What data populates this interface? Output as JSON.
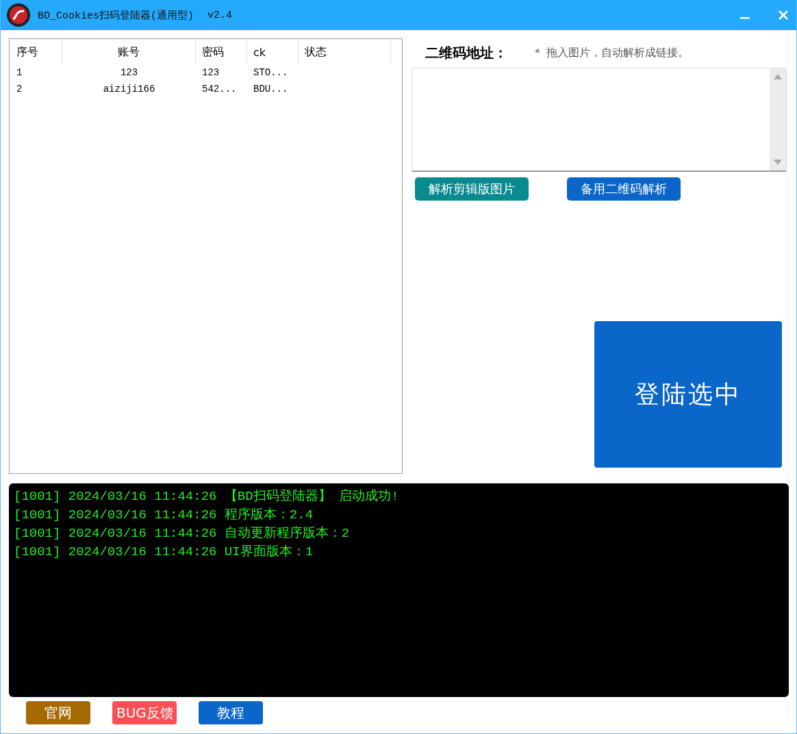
{
  "window": {
    "title": "BD_Cookies扫码登陆器(通用型)",
    "version": "v2.4"
  },
  "table": {
    "columns": [
      "序号",
      "账号",
      "密码",
      "ck",
      "状态"
    ],
    "rows": [
      [
        "1",
        "123",
        "123",
        "STO...",
        ""
      ],
      [
        "2",
        "aiziji166",
        "542...",
        "BDU...",
        ""
      ]
    ]
  },
  "qr": {
    "label": "二维码地址：",
    "hint": "＊ 拖入图片，自动解析成链接。",
    "buttons": [
      {
        "label": "解析剪辑版图片",
        "color": "#098a8f"
      },
      {
        "label": "备用二维码解析",
        "color": "#0a66c8"
      }
    ]
  },
  "login_button": "登陆选中",
  "log": [
    "[1001] 2024/03/16 11:44:26 【BD扫码登陆器】 启动成功!",
    "[1001] 2024/03/16 11:44:26 程序版本：2.4",
    "[1001] 2024/03/16 11:44:26 自动更新程序版本：2",
    "[1001] 2024/03/16 11:44:26 UI界面版本：1"
  ],
  "footer": [
    {
      "label": "官网",
      "color": "#a56b00"
    },
    {
      "label": "BUG反馈",
      "color": "#f85055"
    },
    {
      "label": "教程",
      "color": "#0a66c8"
    }
  ]
}
